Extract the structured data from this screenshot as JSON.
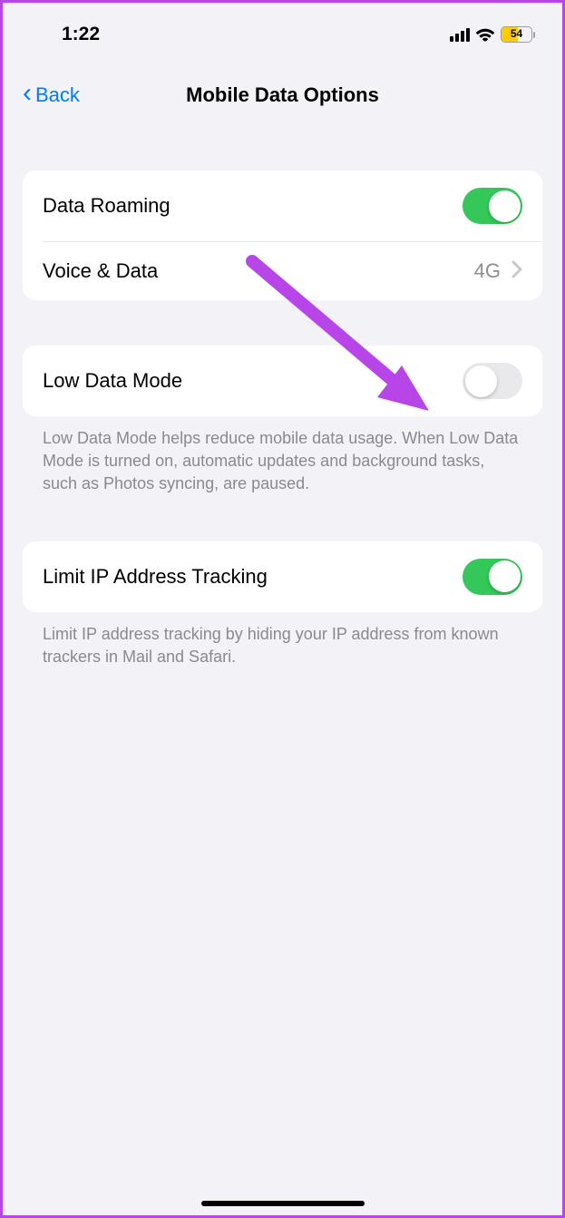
{
  "status": {
    "time": "1:22",
    "battery_percent": "54"
  },
  "nav": {
    "back_label": "Back",
    "title": "Mobile Data Options"
  },
  "rows": {
    "data_roaming": {
      "label": "Data Roaming",
      "on": true
    },
    "voice_data": {
      "label": "Voice & Data",
      "value": "4G"
    },
    "low_data_mode": {
      "label": "Low Data Mode",
      "on": false
    },
    "limit_ip": {
      "label": "Limit IP Address Tracking",
      "on": true
    }
  },
  "footers": {
    "low_data": "Low Data Mode helps reduce mobile data usage. When Low Data Mode is turned on, automatic updates and background tasks, such as Photos syncing, are paused.",
    "limit_ip": "Limit IP address tracking by hiding your IP address from known trackers in Mail and Safari."
  }
}
